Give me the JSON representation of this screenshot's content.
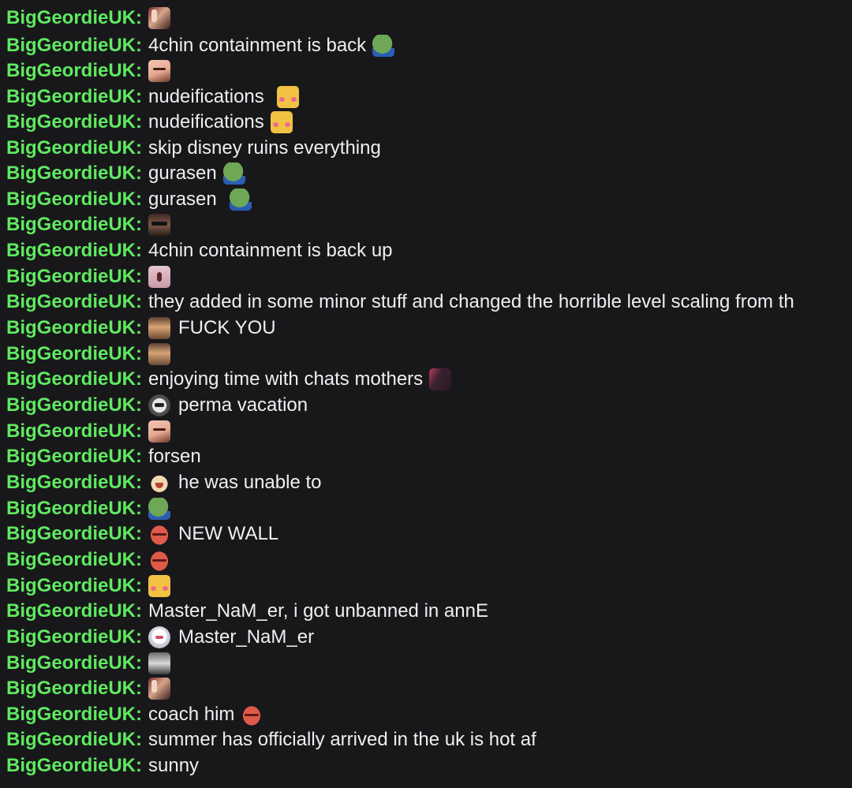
{
  "chat": {
    "username": "BigGeordieUK",
    "colon": ":",
    "colors": {
      "username": "#5fea5f",
      "message": "#efeff1",
      "background": "#18181b"
    },
    "messages": [
      {
        "pre": "peace-sign-emote",
        "text": "",
        "post": ""
      },
      {
        "pre": "",
        "text": "4chin containment is back",
        "post": "pepe-emote"
      },
      {
        "pre": "face-emote",
        "text": "",
        "post": ""
      },
      {
        "pre": "",
        "text": "nudeifications",
        "post": "blush-emote"
      },
      {
        "pre": "",
        "text": "nudeifications",
        "post": "blush-emote"
      },
      {
        "pre": "",
        "text": "skip disney ruins everything",
        "post": ""
      },
      {
        "pre": "",
        "text": "gurasen",
        "post": "pepe-emote"
      },
      {
        "pre": "",
        "text": "gurasen",
        "post": "pepe-emote"
      },
      {
        "pre": "sunglasses-emote",
        "text": "",
        "post": ""
      },
      {
        "pre": "",
        "text": "4chin containment is back up",
        "post": ""
      },
      {
        "pre": "pink-face-emote",
        "text": "",
        "post": ""
      },
      {
        "pre": "",
        "text": "they added in some minor stuff and changed the horrible level scaling from th",
        "post": ""
      },
      {
        "pre": "wall-emote",
        "text": "FUCK YOU",
        "post": ""
      },
      {
        "pre": "wall-emote",
        "text": "",
        "post": ""
      },
      {
        "pre": "",
        "text": "enjoying time with chats mothers",
        "post": "dark-face-emote"
      },
      {
        "pre": "gray-face-emote",
        "text": "perma vacation",
        "post": ""
      },
      {
        "pre": "face-emote",
        "text": "",
        "post": ""
      },
      {
        "pre": "",
        "text": "forsen",
        "post": ""
      },
      {
        "pre": "laugh-emote",
        "text": "he was unable to",
        "post": ""
      },
      {
        "pre": "pepe-emote",
        "text": "",
        "post": ""
      },
      {
        "pre": "lips-emote",
        "text": "NEW WALL",
        "post": ""
      },
      {
        "pre": "lips-emote",
        "text": "",
        "post": ""
      },
      {
        "pre": "blush-emote",
        "text": "",
        "post": ""
      },
      {
        "pre": "",
        "text": "Master_NaM_er, i got unbanned in annE",
        "post": ""
      },
      {
        "pre": "anime-emote",
        "text": "Master_NaM_er",
        "post": ""
      },
      {
        "pre": "stack-emote",
        "text": "",
        "post": ""
      },
      {
        "pre": "peace-sign-emote",
        "text": "",
        "post": ""
      },
      {
        "pre": "",
        "text": "coach him",
        "post": "lips-emote"
      },
      {
        "pre": "",
        "text": "summer has officially arrived in the uk is hot af",
        "post": ""
      },
      {
        "pre": "",
        "text": "sunny",
        "post": ""
      }
    ]
  }
}
